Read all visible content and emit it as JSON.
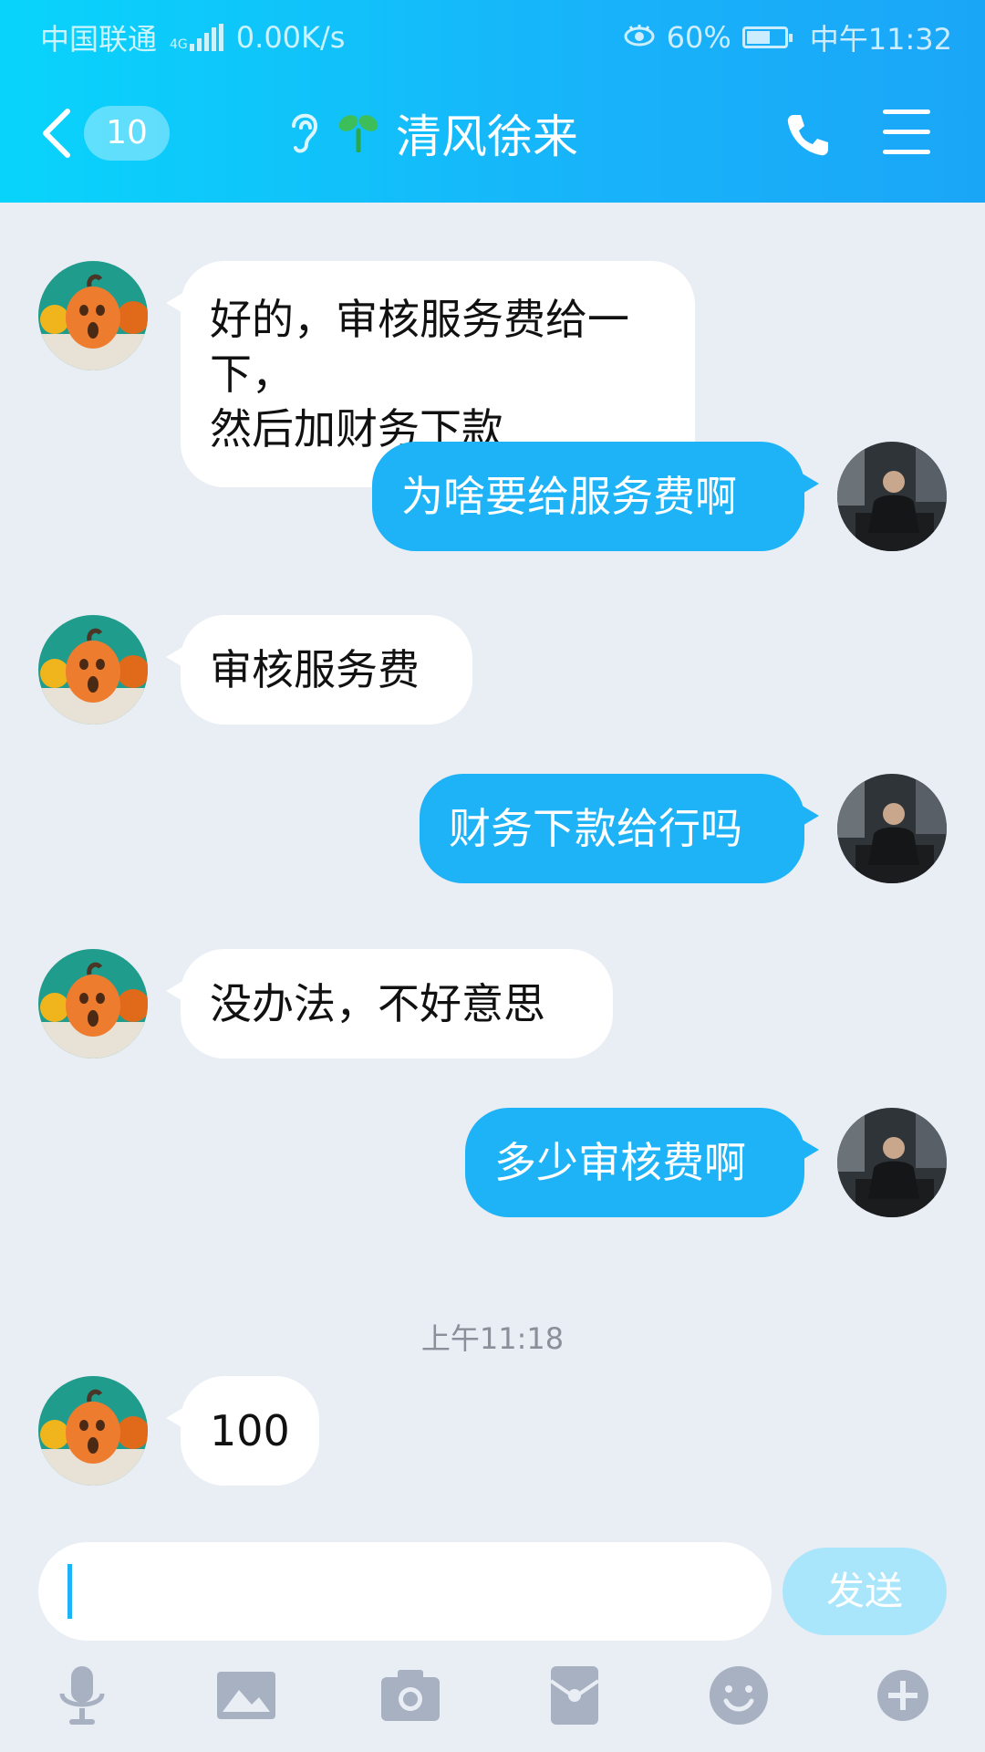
{
  "status_bar": {
    "carrier": "中国联通",
    "network": "4G",
    "speed": "0.00K/s",
    "battery": "60%",
    "time": "中午11:32"
  },
  "header": {
    "unread_count": "10",
    "contact_name": "清风徐来",
    "icons": [
      "back-icon",
      "ear-icon",
      "sprout-icon",
      "phone-icon",
      "menu-icon"
    ]
  },
  "messages": [
    {
      "side": "in",
      "lines": [
        "好的，审核服务费给一下，",
        "然后加财务下款"
      ]
    },
    {
      "side": "out",
      "lines": [
        "为啥要给服务费啊"
      ]
    },
    {
      "side": "in",
      "lines": [
        "审核服务费"
      ]
    },
    {
      "side": "out",
      "lines": [
        "财务下款给行吗"
      ]
    },
    {
      "side": "in",
      "lines": [
        "没办法，不好意思"
      ]
    },
    {
      "side": "out",
      "lines": [
        "多少审核费啊"
      ]
    },
    {
      "side": "in",
      "lines": [
        "100"
      ]
    }
  ],
  "timestamp": "上午11:18",
  "input": {
    "value": "",
    "send_label": "发送"
  },
  "toolbar": [
    "voice-icon",
    "image-icon",
    "camera-icon",
    "red-packet-icon",
    "emoji-icon",
    "plus-icon"
  ],
  "colors": {
    "accent": "#1eb3f7",
    "header_start": "#08d4fb",
    "header_end": "#1aa6f7",
    "background": "#e9edf4",
    "incoming_bubble": "#ffffff",
    "send_disabled": "#a9e6fb"
  }
}
